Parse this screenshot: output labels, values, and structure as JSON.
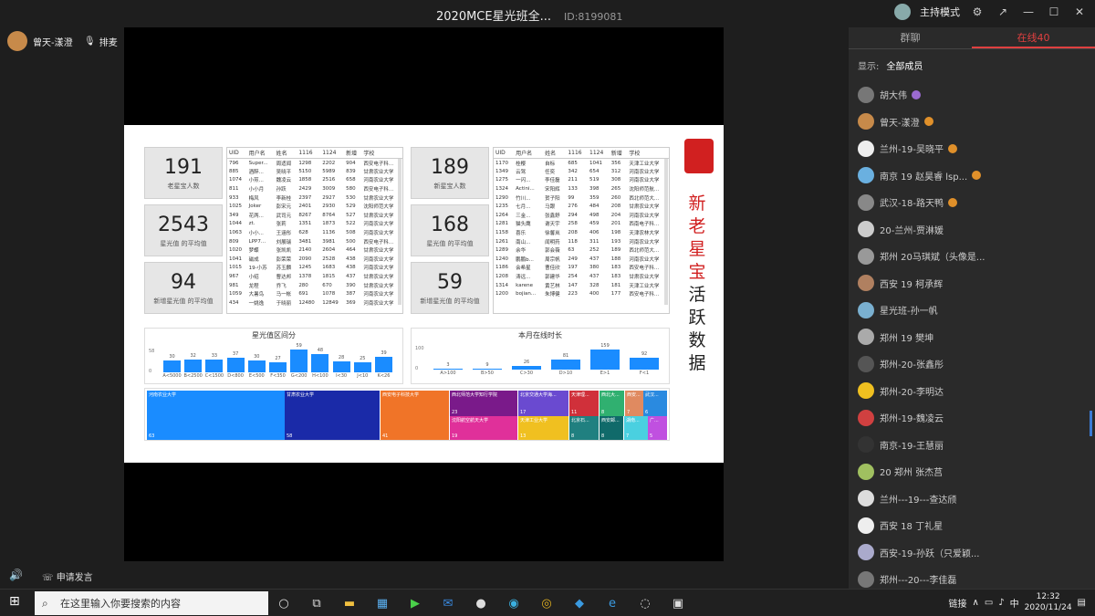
{
  "window": {
    "title": "2020MCE星光班全...",
    "id": "ID:8199081",
    "host_mode": "主持模式"
  },
  "speaker": {
    "name": "曾天-漾澄",
    "raise": "排麦"
  },
  "bottom": {
    "apply": "申请发言"
  },
  "slide": {
    "stats_left": [
      {
        "num": "191",
        "label": "老星宝人数"
      },
      {
        "num": "2543",
        "label": "星光值 的平均值"
      },
      {
        "num": "94",
        "label": "新增星光值 的平均值"
      }
    ],
    "stats_right": [
      {
        "num": "189",
        "label": "新星宝人数"
      },
      {
        "num": "168",
        "label": "星光值 的平均值"
      },
      {
        "num": "59",
        "label": "新增星光值 的平均值"
      }
    ],
    "table_headers": [
      "UID",
      "用户名",
      "姓名",
      "1116",
      "1124",
      "新增",
      "学校"
    ],
    "table_left": [
      [
        "796",
        "Super...",
        "周适闻",
        "1298",
        "2202",
        "904",
        "西安电子科..."
      ],
      [
        "885",
        "酒醉...",
        "吴晓平",
        "5150",
        "5989",
        "839",
        "甘肃农业大学"
      ],
      [
        "1074",
        "小煎...",
        "魏凌云",
        "1858",
        "2516",
        "658",
        "河南农业大学"
      ],
      [
        "811",
        "小小月",
        "孙跃",
        "2429",
        "3009",
        "580",
        "西安电子科..."
      ],
      [
        "933",
        "梅风",
        "李新桂",
        "2397",
        "2927",
        "530",
        "甘肃农业大学"
      ],
      [
        "1025",
        "Joker",
        "彭宋元",
        "2401",
        "2930",
        "529",
        "沈阳师范大学"
      ],
      [
        "349",
        "花两...",
        "武司元",
        "8267",
        "8764",
        "527",
        "甘肃农业大学"
      ],
      [
        "1044",
        "zt.",
        "张莉",
        "1351",
        "1873",
        "522",
        "河南农业大学"
      ],
      [
        "1063",
        "小小...",
        "王涵彤",
        "628",
        "1136",
        "508",
        "河南农业大学"
      ],
      [
        "809",
        "LPP7...",
        "刘展瑞",
        "3481",
        "3981",
        "500",
        "西安电子科..."
      ],
      [
        "1020",
        "梦蝶",
        "张凯凯",
        "2140",
        "2604",
        "464",
        "甘肃农业大学"
      ],
      [
        "1041",
        "磁成",
        "彭荣荣",
        "2090",
        "2528",
        "438",
        "河南农业大学"
      ],
      [
        "1015",
        "19-小苏",
        "苏玉麟",
        "1245",
        "1683",
        "438",
        "河南农业大学"
      ],
      [
        "967",
        "小绍",
        "曹达邦",
        "1378",
        "1815",
        "437",
        "甘肃农业大学"
      ],
      [
        "981",
        "龙程",
        "乔飞",
        "280",
        "670",
        "390",
        "甘肃农业大学"
      ],
      [
        "1059",
        "大暑鸟",
        "马一帐",
        "691",
        "1078",
        "387",
        "河南农业大学"
      ],
      [
        "434",
        "一姚逸",
        "于晓丽",
        "12480",
        "12849",
        "369",
        "河南农业大学"
      ]
    ],
    "table_right": [
      [
        "1170",
        "桂樱",
        "自标",
        "685",
        "1041",
        "356",
        "天津工业大学"
      ],
      [
        "1349",
        "云驾",
        "任奕",
        "342",
        "654",
        "312",
        "河南农业大学"
      ],
      [
        "1275",
        "一闪...",
        "李佳磊",
        "211",
        "519",
        "308",
        "河南农业大学"
      ],
      [
        "1324",
        "Actini...",
        "宋阳辉",
        "133",
        "398",
        "265",
        "沈阳师范航..."
      ],
      [
        "1290",
        "竹川...",
        "贺子阳",
        "99",
        "359",
        "260",
        "西北师范大..."
      ],
      [
        "1235",
        "七月...",
        "马跟",
        "276",
        "484",
        "208",
        "甘肃农业大学"
      ],
      [
        "1264",
        "三金...",
        "张鑫舒",
        "294",
        "498",
        "204",
        "河南农业大学"
      ],
      [
        "1281",
        "猫头鹰",
        "谢天宇",
        "258",
        "459",
        "201",
        "西南电子科..."
      ],
      [
        "1158",
        "喜乐",
        "徐馨岚",
        "208",
        "406",
        "198",
        "天津农林大学"
      ],
      [
        "1261",
        "南山...",
        "闻明药",
        "118",
        "311",
        "193",
        "河南农业大学"
      ],
      [
        "1289",
        "余华",
        "郭会薇",
        "63",
        "252",
        "189",
        "西北师范大..."
      ],
      [
        "1240",
        "鹏鹏b...",
        "周宗帆",
        "249",
        "437",
        "188",
        "河南农业大学"
      ],
      [
        "1186",
        "会希星",
        "曹佳欣",
        "197",
        "380",
        "183",
        "西安电子科..."
      ],
      [
        "1208",
        "涛远...",
        "郭建华",
        "254",
        "437",
        "183",
        "甘肃农业大学"
      ],
      [
        "1314",
        "karene",
        "黄艺林",
        "147",
        "328",
        "181",
        "天津工业大学"
      ],
      [
        "1200",
        "bojian...",
        "朱博健",
        "223",
        "400",
        "177",
        "西安电子科..."
      ]
    ],
    "bar1": {
      "title": "星光值区间分",
      "ymax": "58",
      "ymin": "0"
    },
    "bar2": {
      "title": "本月在线时长",
      "ymax": "100",
      "ymin": "0"
    },
    "treemap": [
      {
        "name": "河南农业大学",
        "val": "63",
        "color": "#1a8cff"
      },
      {
        "name": "甘肃农业大学",
        "val": "58",
        "color": "#1a2aa8"
      },
      {
        "name": "西安电子科技大学",
        "val": "41",
        "color": "#f07428"
      },
      {
        "name": "西北师范大学知行学院",
        "val": "23",
        "color": "#7a1a8a"
      },
      {
        "name": "沈阳航空航天大学",
        "val": "19",
        "color": "#e0309a"
      },
      {
        "name": "北京交通大学海...",
        "val": "17",
        "color": "#6a4ad0"
      },
      {
        "name": "天津工业大学",
        "val": "13",
        "color": "#f0c020"
      },
      {
        "name": "天津理...",
        "val": "11",
        "color": "#d0303a"
      },
      {
        "name": "北京石...",
        "val": "8",
        "color": "#208080"
      },
      {
        "name": "西北大...",
        "val": "8",
        "color": "#30b070"
      },
      {
        "name": "西安...",
        "val": "7",
        "color": "#e08a60"
      },
      {
        "name": "武汉...",
        "val": "6",
        "color": "#2a8ae0"
      },
      {
        "name": "西安邮...",
        "val": "8",
        "color": "#106a6a"
      },
      {
        "name": "湖南...",
        "val": "7",
        "color": "#4ad0e0"
      },
      {
        "name": "广...",
        "val": "5",
        "color": "#c050e0"
      }
    ],
    "vertical_title": [
      "新",
      "老",
      "星",
      "宝",
      "活",
      "跃",
      "数",
      "据"
    ]
  },
  "chart_data": [
    {
      "type": "bar",
      "title": "星光值区间分",
      "categories": [
        "A<5000",
        "B<2500",
        "C<1500",
        "D<800",
        "E<500",
        "F<350",
        "G<200",
        "H<100",
        "I<30",
        "J<10",
        "K<26"
      ],
      "values": [
        30,
        32,
        33,
        37,
        30,
        27,
        59,
        48,
        28,
        25,
        39
      ],
      "ylim": [
        0,
        58
      ]
    },
    {
      "type": "bar",
      "title": "本月在线时长",
      "categories": [
        "A>100",
        "B>50",
        "C>30",
        "D>10",
        "E>1",
        "F<1"
      ],
      "values": [
        3,
        9,
        26,
        81,
        159,
        92
      ],
      "ylim": [
        0,
        100
      ]
    }
  ],
  "sidebar": {
    "tabs": [
      "群聊",
      "在线40"
    ],
    "show_label": "显示:",
    "show_value": "全部成员",
    "members": [
      {
        "name": "胡大伟",
        "c": "#777",
        "b": "#9a6ad0"
      },
      {
        "name": "曾天-漾澄",
        "c": "#c78a4a",
        "b": "#e0902a"
      },
      {
        "name": "兰州-19-吴晓平",
        "c": "#eee",
        "b": "#e0902a"
      },
      {
        "name": "南京 19 赵昊睿 lsp...",
        "c": "#6ab0e0",
        "b": "#e0902a"
      },
      {
        "name": "武汉-18-路天鸭",
        "c": "#888",
        "b": "#e0902a"
      },
      {
        "name": "20-兰州-贾淋媛",
        "c": "#ccc",
        "b": ""
      },
      {
        "name": "郑州 20马琪斌（头像是...",
        "c": "#999",
        "b": ""
      },
      {
        "name": "西安 19 柯承辉",
        "c": "#b08060",
        "b": ""
      },
      {
        "name": "星光班-孙一帆",
        "c": "#7ab0d0",
        "b": ""
      },
      {
        "name": "郑州 19 樊坤",
        "c": "#aaa",
        "b": ""
      },
      {
        "name": "郑州-20-张鑫彤",
        "c": "#555",
        "b": ""
      },
      {
        "name": "郑州-20-李明达",
        "c": "#f0c020",
        "b": ""
      },
      {
        "name": "郑州-19-魏凌云",
        "c": "#d04040",
        "b": ""
      },
      {
        "name": "南京-19-王慧丽",
        "c": "#333",
        "b": ""
      },
      {
        "name": "20 郑州 张杰莒",
        "c": "#a0c060",
        "b": ""
      },
      {
        "name": "兰州---19---查达颀",
        "c": "#ddd",
        "b": ""
      },
      {
        "name": "西安 18 丁礼星",
        "c": "#eee",
        "b": ""
      },
      {
        "name": "西安-19-孙跃（只爱颖...",
        "c": "#aac",
        "b": ""
      },
      {
        "name": "郑州---20---李佳磊",
        "c": "#777",
        "b": ""
      }
    ]
  },
  "taskbar": {
    "search_placeholder": "在这里输入你要搜索的内容",
    "link": "链接",
    "time": "12:32",
    "date": "2020/11/24"
  }
}
